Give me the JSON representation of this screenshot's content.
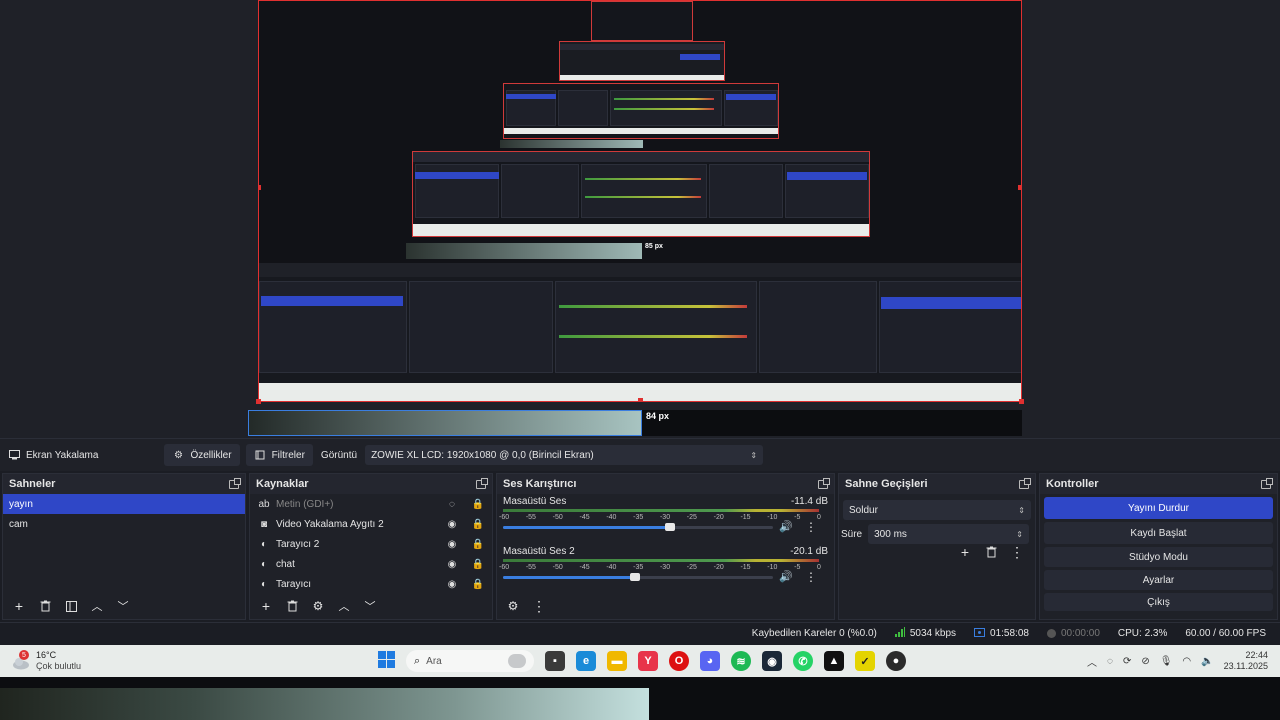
{
  "source_bar": {
    "source_name": "Ekran Yakalama",
    "properties_label": "Özellikler",
    "filters_label": "Filtreler",
    "display_label": "Görüntü",
    "display_value": "ZOWIE XL LCD: 1920x1080 @ 0,0 (Birincil Ekran)"
  },
  "preview": {
    "crop_label_main": "84 px",
    "crop_label_nested": "85 px"
  },
  "scenes": {
    "title": "Sahneler",
    "items": [
      "yayın",
      "cam"
    ],
    "selected": 0
  },
  "sources": {
    "title": "Kaynaklar",
    "items": [
      {
        "name": "Metin (GDI+)",
        "icon": "text-icon",
        "hidden": true
      },
      {
        "name": "Video Yakalama Aygıtı 2",
        "icon": "camera-icon",
        "hidden": false
      },
      {
        "name": "Tarayıcı 2",
        "icon": "globe-icon",
        "hidden": false
      },
      {
        "name": "chat",
        "icon": "globe-icon",
        "hidden": false
      },
      {
        "name": "Tarayıcı",
        "icon": "globe-icon",
        "hidden": false
      }
    ]
  },
  "mixer": {
    "title": "Ses Karıştırıcı",
    "channels": [
      {
        "name": "Masaüstü Ses",
        "db": "-11.4 dB",
        "level": 0.62
      },
      {
        "name": "Masaüstü Ses 2",
        "db": "-20.1 dB",
        "level": 0.49
      }
    ],
    "ticks": [
      "-60",
      "-55",
      "-50",
      "-45",
      "-40",
      "-35",
      "-30",
      "-25",
      "-20",
      "-15",
      "-10",
      "-5",
      "0"
    ]
  },
  "transitions": {
    "title": "Sahne Geçişleri",
    "transition": "Soldur",
    "duration_label": "Süre",
    "duration_value": "300 ms"
  },
  "controls": {
    "title": "Kontroller",
    "stop_stream": "Yayını Durdur",
    "start_recording": "Kaydı Başlat",
    "studio_mode": "Stüdyo Modu",
    "settings": "Ayarlar",
    "exit": "Çıkış"
  },
  "status": {
    "dropped_frames": "Kaybedilen Kareler 0 (%0.0)",
    "bitrate": "5034 kbps",
    "stream_time": "01:58:08",
    "record_time": "00:00:00",
    "cpu": "CPU: 2.3%",
    "fps": "60.00 / 60.00 FPS"
  },
  "taskbar": {
    "weather_temp": "16°C",
    "weather_desc": "Çok bulutlu",
    "weather_badge": "5",
    "search_placeholder": "Ara",
    "time": "22:44",
    "date": "23.11.2025"
  },
  "colors": {
    "accent": "#2f47c7",
    "recording_border": "#e03030",
    "panel_bg": "#1f2128"
  }
}
